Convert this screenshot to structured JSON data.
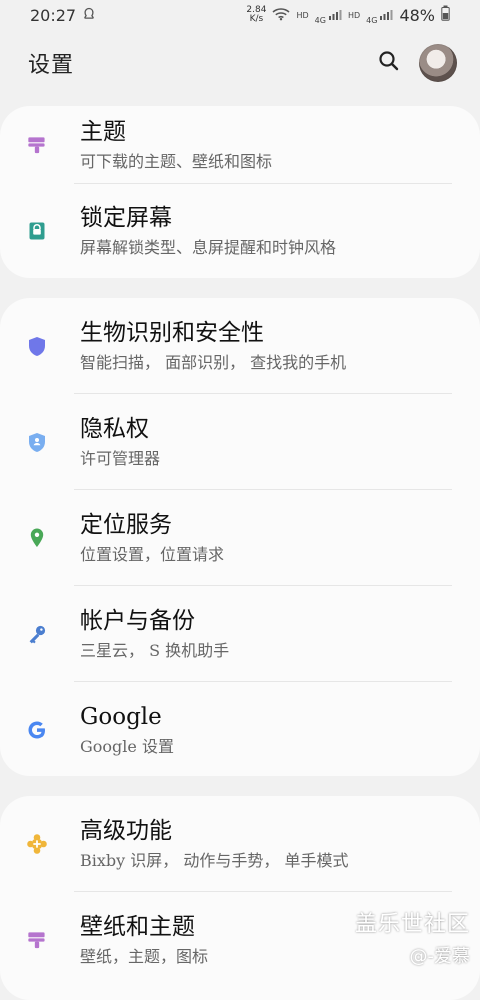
{
  "status_bar": {
    "time": "20:27",
    "speed_value": "2.84",
    "speed_unit": "K/s",
    "battery": "48%",
    "hd1": "HD",
    "hd2": "HD",
    "net1": "4G",
    "net2": "4G"
  },
  "header": {
    "title": "设置"
  },
  "cards": [
    {
      "rows": [
        {
          "title": "主题",
          "subtitle": "可下载的主题、壁纸和图标",
          "icon": "paint-roller-icon",
          "icon_color": "#b574ce"
        },
        {
          "title": "锁定屏幕",
          "subtitle": "屏幕解锁类型、息屏提醒和时钟风格",
          "icon": "lock-screen-icon",
          "icon_color": "#2f9d8f"
        }
      ]
    },
    {
      "rows": [
        {
          "title": "生物识别和安全性",
          "subtitle": "智能扫描， 面部识别， 查找我的手机",
          "icon": "shield-icon",
          "icon_color": "#6f77e9"
        },
        {
          "title": "隐私权",
          "subtitle": "许可管理器",
          "icon": "privacy-shield-icon",
          "icon_color": "#79aef0"
        },
        {
          "title": "定位服务",
          "subtitle": "位置设置，位置请求",
          "icon": "location-pin-icon",
          "icon_color": "#49a857"
        },
        {
          "title": "帐户与备份",
          "subtitle": "三星云， S 换机助手",
          "icon": "key-icon",
          "icon_color": "#4b7ecf"
        },
        {
          "title": "Google",
          "subtitle": "Google 设置",
          "icon": "google-icon",
          "icon_color": "#4a87f1"
        }
      ]
    },
    {
      "rows": [
        {
          "title": "高级功能",
          "subtitle": "Bixby 识屏， 动作与手势， 单手模式",
          "icon": "puzzle-icon",
          "icon_color": "#f0b63a"
        },
        {
          "title": "壁纸和主题",
          "subtitle": "壁纸，主题，图标",
          "icon": "paint-roller-icon",
          "icon_color": "#b574ce"
        }
      ]
    }
  ],
  "watermark": {
    "main": "盖乐世社区",
    "sub": "@-爱慕"
  }
}
